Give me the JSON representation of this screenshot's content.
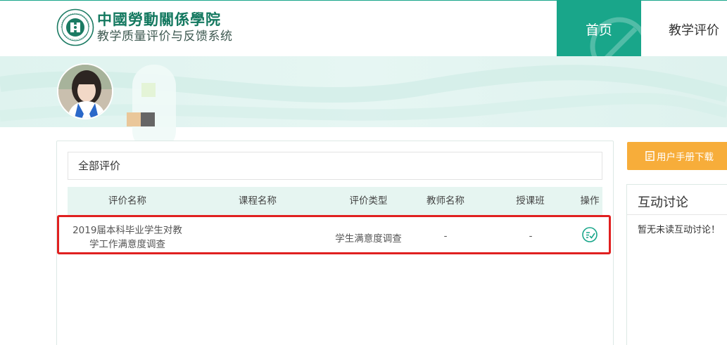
{
  "header": {
    "logo_cn": "中國勞動關係學院",
    "logo_sub": "教学质量评价与反馈系统",
    "nav": {
      "home": "首页",
      "eval": "教学评价"
    }
  },
  "main": {
    "filter_label": "全部评价",
    "columns": [
      "评价名称",
      "课程名称",
      "评价类型",
      "教师名称",
      "授课班",
      "操作"
    ],
    "rows": [
      {
        "name_line1": "2019届本科毕业学生对教",
        "name_line2": "学工作满意度调查",
        "course": "",
        "type": "学生满意度调查",
        "teacher": "-",
        "class": "-",
        "action_icon": "evaluate-icon"
      }
    ]
  },
  "sidebar": {
    "manual_button": "用户手册下载",
    "discussion_title": "互动讨论",
    "discussion_empty": "暂无未读互动讨论！"
  },
  "colors": {
    "primary": "#19a68a",
    "accent": "#f7ad3a",
    "highlight": "#e02020",
    "table_header": "#e6f5f1"
  }
}
